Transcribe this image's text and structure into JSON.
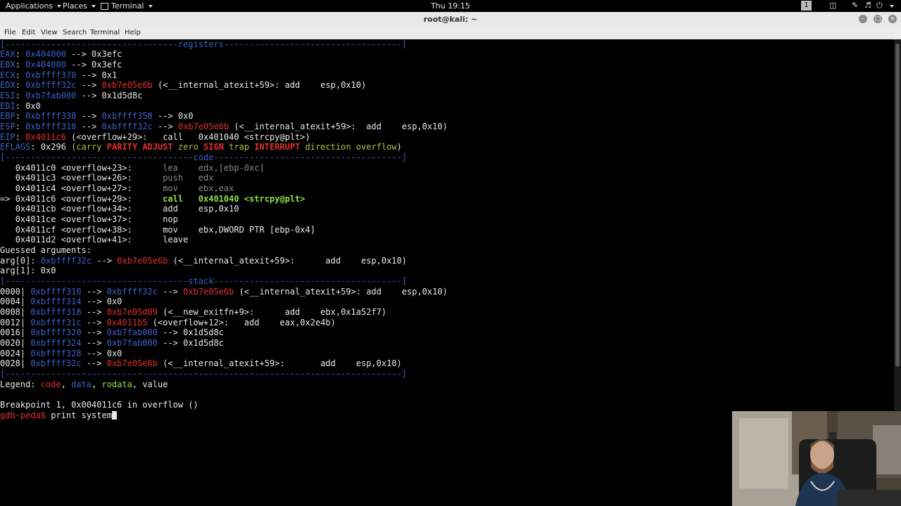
{
  "topbar": {
    "applications": "Applications",
    "places": "Places",
    "terminal": "Terminal",
    "clock": "Thu 19:15",
    "workspace": "1"
  },
  "window": {
    "title": "root@kali: ~"
  },
  "menu": [
    "File",
    "Edit",
    "View",
    "Search",
    "Terminal",
    "Help"
  ],
  "sections": {
    "registers": "[----------------------------------registers-----------------------------------]",
    "code": "[-------------------------------------code-------------------------------------]",
    "stack": "[------------------------------------stack-------------------------------------]",
    "end": "[------------------------------------------------------------------------------]"
  },
  "registers": {
    "eax": {
      "label": "EAX",
      "addr": "0x404000",
      "val": " --> 0x3efc"
    },
    "ebx": {
      "label": "EBX",
      "addr": "0x404000",
      "val": " --> 0x3efc"
    },
    "ecx": {
      "label": "ECX",
      "addr": "0xbffff370",
      "val": " --> 0x1"
    },
    "edx": {
      "label": "EDX",
      "addr": "0xbffff32c",
      "arrow": " --> ",
      "ptr": "0xb7e05e6b",
      "rest": " (<__internal_atexit+59>: add    esp,0x10)"
    },
    "esi": {
      "label": "ESI",
      "addr": "0xb7fab000",
      "val": " --> 0x1d5d8c"
    },
    "edi": {
      "label": "EDI",
      "val": "0x0"
    },
    "ebp": {
      "label": "EBP",
      "addr": "0xbffff338",
      "arrow": " --> ",
      "addr2": "0xbffff358",
      "val": " --> 0x0"
    },
    "esp": {
      "label": "ESP",
      "addr": "0xbffff310",
      "arrow": " --> ",
      "addr2": "0xbffff32c",
      "arrow2": " --> ",
      "ptr": "0xb7e05e6b",
      "rest": " (<__internal_atexit+59>:  add    esp,0x10)"
    },
    "eip": {
      "label": "EIP",
      "ptr": "0x4011c6",
      "rest": " (<overflow+29>:   call   0x401040 <strcpy@plt>)"
    },
    "eflags": {
      "label": "EFLAGS",
      "val": "0x296 ",
      "p1": "(",
      "carry": "carry ",
      "parity": "PARITY ",
      "adjust": "ADJUST ",
      "zero": "zero ",
      "sign": "SIGN ",
      "trap": "trap ",
      "interrupt": "INTERRUPT ",
      "direction": "direction ",
      "overflow": "overflow",
      "p2": ")"
    }
  },
  "code": [
    {
      "prefix": "   ",
      "addr": "0x4011c0 <overflow+23>:      ",
      "instr": "lea    edx,[ebp-0xc]"
    },
    {
      "prefix": "   ",
      "addr": "0x4011c3 <overflow+26>:      ",
      "instr": "push   edx"
    },
    {
      "prefix": "   ",
      "addr": "0x4011c4 <overflow+27>:      ",
      "instr": "mov    ebx,eax"
    },
    {
      "prefix": "=> ",
      "addr": "0x4011c6 <overflow+29>:      ",
      "instr": "call   0x401040 <strcpy@plt>"
    },
    {
      "prefix": "   ",
      "addr": "0x4011cb <overflow+34>:      ",
      "instr": "add    esp,0x10"
    },
    {
      "prefix": "   ",
      "addr": "0x4011ce <overflow+37>:      ",
      "instr": "nop"
    },
    {
      "prefix": "   ",
      "addr": "0x4011cf <overflow+38>:      ",
      "instr": "mov    ebx,DWORD PTR [ebp-0x4]"
    },
    {
      "prefix": "   ",
      "addr": "0x4011d2 <overflow+41>:      ",
      "instr": "leave"
    }
  ],
  "guessed": {
    "header": "Guessed arguments:",
    "arg0_label": "arg[0]: ",
    "arg0_addr": "0xbffff32c",
    "arg0_arrow": " --> ",
    "arg0_ptr": "0xb7e05e6b",
    "arg0_rest": " (<__internal_atexit+59>:      add    esp,0x10)",
    "arg1": "arg[1]: 0x0"
  },
  "stack": [
    {
      "off": "0000| ",
      "addr": "0xbffff310",
      "a1": " --> ",
      "addr2": "0xbffff32c",
      "a2": " --> ",
      "ptr": "0xb7e05e6b",
      "rest": " (<__internal_atexit+59>: add    esp,0x10)"
    },
    {
      "off": "0004| ",
      "addr": "0xbffff314",
      "a1": " --> 0x0"
    },
    {
      "off": "0008| ",
      "addr": "0xbffff318",
      "a1": " --> ",
      "ptr": "0xb7e05d09",
      "rest": " (<__new_exitfn+9>:      add    ebx,0x1a52f7)"
    },
    {
      "off": "0012| ",
      "addr": "0xbffff31c",
      "a1": " --> ",
      "ptr": "0x4011b5",
      "rest": " (<overflow+12>:   add    eax,0x2e4b)"
    },
    {
      "off": "0016| ",
      "addr": "0xbffff320",
      "a1": " --> ",
      "addr2": "0xb7fab000",
      "a2": " --> 0x1d5d8c"
    },
    {
      "off": "0020| ",
      "addr": "0xbffff324",
      "a1": " --> ",
      "addr2": "0xb7fab000",
      "a2": " --> 0x1d5d8c"
    },
    {
      "off": "0024| ",
      "addr": "0xbffff328",
      "a1": " --> 0x0"
    },
    {
      "off": "0028| ",
      "addr": "0xbffff32c",
      "a1": " --> ",
      "ptr": "0xb7e05e6b",
      "rest": " (<__internal_atexit+59>:       add    esp,0x10)"
    }
  ],
  "legend": {
    "label": "Legend: ",
    "code": "code",
    "sep1": ", ",
    "data": "data",
    "sep2": ", ",
    "rodata": "rodata",
    "sep3": ", ",
    "value": "value"
  },
  "breakpoint": "Breakpoint 1, 0x004011c6 in overflow ()",
  "prompt": {
    "text": "gdb-peda$",
    "command": " print system"
  },
  "colors": {
    "blue": "#3d60c8",
    "red": "#e23030",
    "green": "#8fe04a",
    "gray": "#888888"
  }
}
